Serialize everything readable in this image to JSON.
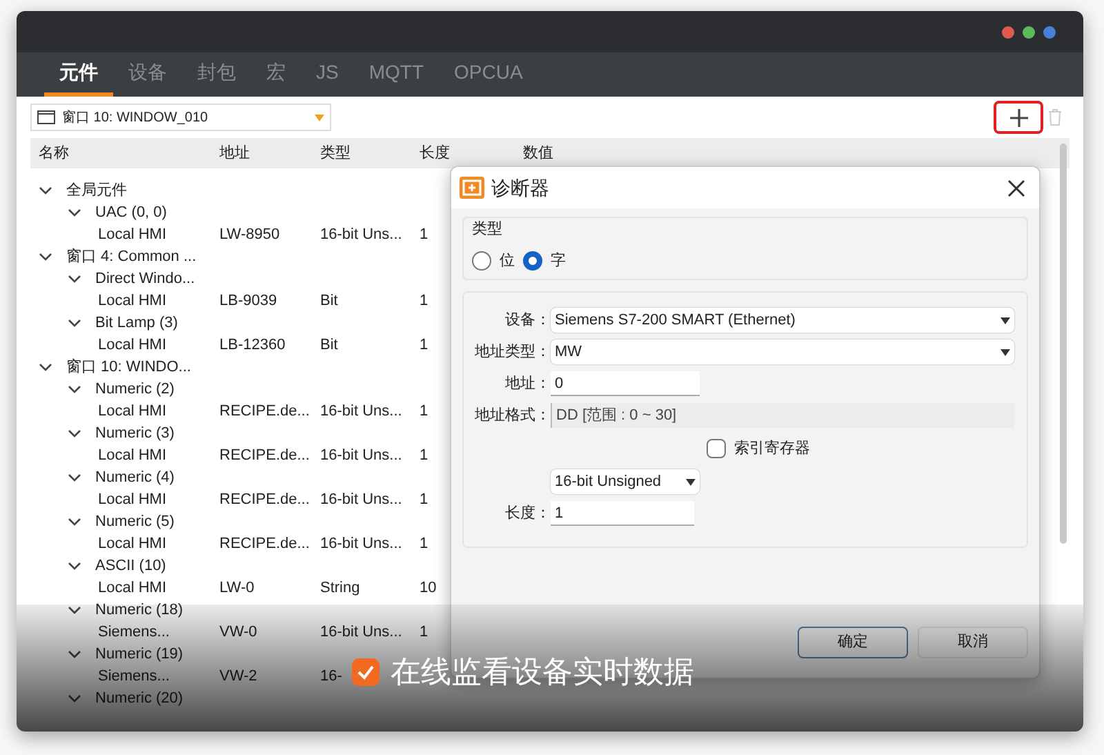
{
  "window": {
    "dots": [
      {
        "color": "#e05a4f"
      },
      {
        "color": "#5bb85b"
      },
      {
        "color": "#4a7fd6"
      }
    ]
  },
  "tabs": [
    {
      "label": "元件",
      "selected": true
    },
    {
      "label": "设备",
      "selected": false
    },
    {
      "label": "封包",
      "selected": false
    },
    {
      "label": "宏",
      "selected": false
    },
    {
      "label": "JS",
      "selected": false
    },
    {
      "label": "MQTT",
      "selected": false
    },
    {
      "label": "OPCUA",
      "selected": false
    }
  ],
  "window_selector": {
    "value": "窗口 10: WINDOW_010"
  },
  "toolbar": {
    "add_highlighted": true
  },
  "table": {
    "columns": [
      "名称",
      "地址",
      "类型",
      "长度",
      "数值"
    ],
    "tree": [
      {
        "label": "全局元件",
        "expanded": true,
        "children": [
          {
            "label": "UAC (0, 0)",
            "expanded": true,
            "children": [
              {
                "name": "Local HMI",
                "address": "LW-8950",
                "type": "16-bit Uns...",
                "length": "1"
              }
            ]
          }
        ]
      },
      {
        "label": "窗口 4: Common ...",
        "expanded": true,
        "children": [
          {
            "label": "Direct Windo...",
            "expanded": true,
            "children": [
              {
                "name": "Local HMI",
                "address": "LB-9039",
                "type": "Bit",
                "length": "1"
              }
            ]
          },
          {
            "label": "Bit Lamp (3)",
            "expanded": true,
            "children": [
              {
                "name": "Local HMI",
                "address": "LB-12360",
                "type": "Bit",
                "length": "1"
              }
            ]
          }
        ]
      },
      {
        "label": "窗口 10: WINDO...",
        "expanded": true,
        "children": [
          {
            "label": "Numeric (2)",
            "expanded": true,
            "children": [
              {
                "name": "Local HMI",
                "address": "RECIPE.de...",
                "type": "16-bit Uns...",
                "length": "1"
              }
            ]
          },
          {
            "label": "Numeric (3)",
            "expanded": true,
            "children": [
              {
                "name": "Local HMI",
                "address": "RECIPE.de...",
                "type": "16-bit Uns...",
                "length": "1"
              }
            ]
          },
          {
            "label": "Numeric (4)",
            "expanded": true,
            "children": [
              {
                "name": "Local HMI",
                "address": "RECIPE.de...",
                "type": "16-bit Uns...",
                "length": "1"
              }
            ]
          },
          {
            "label": "Numeric (5)",
            "expanded": true,
            "children": [
              {
                "name": "Local HMI",
                "address": "RECIPE.de...",
                "type": "16-bit Uns...",
                "length": "1"
              }
            ]
          },
          {
            "label": "ASCII (10)",
            "expanded": true,
            "children": [
              {
                "name": "Local HMI",
                "address": "LW-0",
                "type": "String",
                "length": "10"
              }
            ]
          },
          {
            "label": "Numeric (18)",
            "expanded": true,
            "children": [
              {
                "name": "Siemens...",
                "address": "VW-0",
                "type": "16-bit Uns...",
                "length": "1"
              }
            ]
          },
          {
            "label": "Numeric (19)",
            "expanded": true,
            "children": [
              {
                "name": "Siemens...",
                "address": "VW-2",
                "type": "16-"
              }
            ]
          },
          {
            "label": "Numeric (20)",
            "expanded": true
          }
        ]
      }
    ]
  },
  "dialog": {
    "title": "诊断器",
    "type_group": {
      "label": "类型",
      "options": [
        {
          "label": "位",
          "selected": false
        },
        {
          "label": "字",
          "selected": true
        }
      ]
    },
    "device": {
      "label": "设备：",
      "value": "Siemens S7-200 SMART (Ethernet)"
    },
    "address_type": {
      "label": "地址类型：",
      "value": "MW"
    },
    "address": {
      "label": "地址：",
      "value": "0"
    },
    "address_format": {
      "label": "地址格式：",
      "value": "DD [范围 : 0 ~ 30]"
    },
    "index_register": {
      "label": "索引寄存器",
      "checked": false
    },
    "data_type": {
      "value": "16-bit Unsigned"
    },
    "length": {
      "label": "长度：",
      "value": "1"
    },
    "buttons": [
      {
        "label": "确定",
        "default": true
      },
      {
        "label": "取消",
        "default": false
      }
    ]
  },
  "caption": {
    "text": "在线监看设备实时数据"
  }
}
